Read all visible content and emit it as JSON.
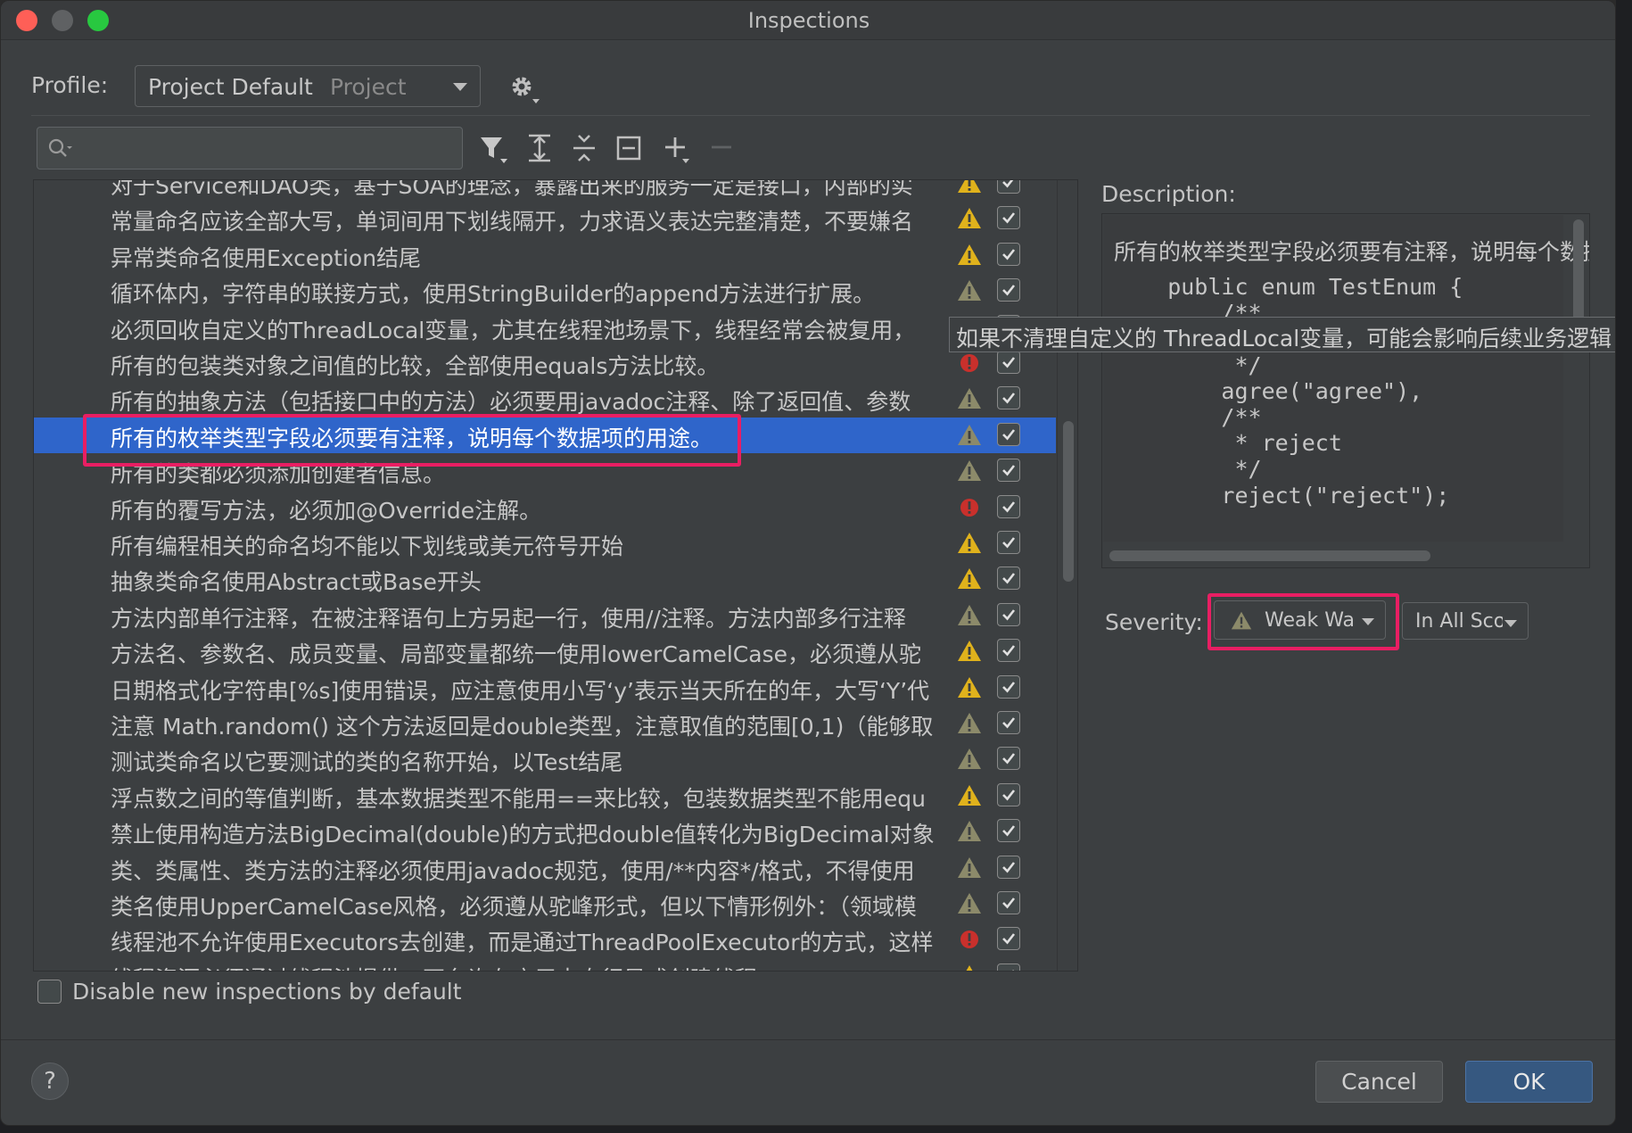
{
  "window": {
    "title": "Inspections"
  },
  "profile": {
    "label": "Profile:",
    "name": "Project Default",
    "scope": "Project"
  },
  "search": {
    "value": ""
  },
  "toolbar_icons": [
    "filter-icon",
    "expand-all-icon",
    "collapse-all-icon",
    "reset-icon",
    "add-icon",
    "remove-icon"
  ],
  "inspections": [
    {
      "text": "对于Service和DAO类，基于SOA的理念，暴露出来的服务一定是接口，内部的实",
      "severity": "warning",
      "checked": true
    },
    {
      "text": "常量命名应该全部大写，单词间用下划线隔开，力求语义表达完整清楚，不要嫌名",
      "severity": "warning",
      "checked": true
    },
    {
      "text": "异常类命名使用Exception结尾",
      "severity": "warning",
      "checked": true
    },
    {
      "text": "循环体内，字符串的联接方式，使用StringBuilder的append方法进行扩展。",
      "severity": "weak",
      "checked": true
    },
    {
      "text": "必须回收自定义的ThreadLocal变量，尤其在线程池场景下，线程经常会被复用，",
      "severity": "none",
      "checked": true
    },
    {
      "text": "所有的包装类对象之间值的比较，全部使用equals方法比较。",
      "severity": "error",
      "checked": true
    },
    {
      "text": "所有的抽象方法（包括接口中的方法）必须要用javadoc注释、除了返回值、参数",
      "severity": "weak",
      "checked": true
    },
    {
      "text": "所有的枚举类型字段必须要有注释，说明每个数据项的用途。",
      "severity": "weak",
      "checked": true
    },
    {
      "text": "所有的类都必须添加创建者信息。",
      "severity": "weak",
      "checked": true
    },
    {
      "text": "所有的覆写方法，必须加@Override注解。",
      "severity": "error",
      "checked": true
    },
    {
      "text": "所有编程相关的命名均不能以下划线或美元符号开始",
      "severity": "warning",
      "checked": true
    },
    {
      "text": "抽象类命名使用Abstract或Base开头",
      "severity": "warning",
      "checked": true
    },
    {
      "text": "方法内部单行注释，在被注释语句上方另起一行，使用//注释。方法内部多行注释",
      "severity": "weak",
      "checked": true
    },
    {
      "text": "方法名、参数名、成员变量、局部变量都统一使用lowerCamelCase，必须遵从驼",
      "severity": "warning",
      "checked": true
    },
    {
      "text": "日期格式化字符串[%s]使用错误，应注意使用小写‘y’表示当天所在的年，大写‘Y’代",
      "severity": "warning",
      "checked": true
    },
    {
      "text": "注意 Math.random() 这个方法返回是double类型，注意取值的范围[0,1)（能够取",
      "severity": "weak",
      "checked": true
    },
    {
      "text": "测试类命名以它要测试的类的名称开始，以Test结尾",
      "severity": "weak",
      "checked": true
    },
    {
      "text": "浮点数之间的等值判断，基本数据类型不能用==来比较，包装数据类型不能用equ",
      "severity": "warning",
      "checked": true
    },
    {
      "text": "禁止使用构造方法BigDecimal(double)的方式把double值转化为BigDecimal对象",
      "severity": "weak",
      "checked": true
    },
    {
      "text": "类、类属性、类方法的注释必须使用javadoc规范，使用/**内容*/格式，不得使用",
      "severity": "weak",
      "checked": true
    },
    {
      "text": "类名使用UpperCamelCase风格，必须遵从驼峰形式，但以下情形例外：（领域模",
      "severity": "weak",
      "checked": true
    },
    {
      "text": "线程池不允许使用Executors去创建，而是通过ThreadPoolExecutor的方式，这样",
      "severity": "error",
      "checked": true
    },
    {
      "text": "线程资源必须通过线程池提供，不允许在应用中自行显式创建线程。",
      "severity": "warning",
      "checked": true
    }
  ],
  "selected_index": 7,
  "tooltip": "如果不清理自定义的 ThreadLocal变量，可能会影响后续业务逻辑",
  "description": {
    "label": "Description:",
    "text": "所有的枚举类型字段必须要有注释，说明每个数据项的用途。",
    "code": [
      "    public enum TestEnum {",
      "        /**",
      "         * agree",
      "         */",
      "        agree(\"agree\"),",
      "        /**",
      "         * reject",
      "         */",
      "        reject(\"reject\");"
    ]
  },
  "severity": {
    "label": "Severity:",
    "value": "Weak Warning",
    "scope": "In All Scopes"
  },
  "disable_new": {
    "label": "Disable new inspections by default",
    "checked": false
  },
  "buttons": {
    "help": "?",
    "cancel": "Cancel",
    "ok": "OK"
  },
  "colors": {
    "selection": "#2f65ca",
    "highlight": "#e91e63",
    "warning": "#e0b21c",
    "weak": "#8c8a6a",
    "error": "#c9302c",
    "ok_button": "#365880"
  }
}
